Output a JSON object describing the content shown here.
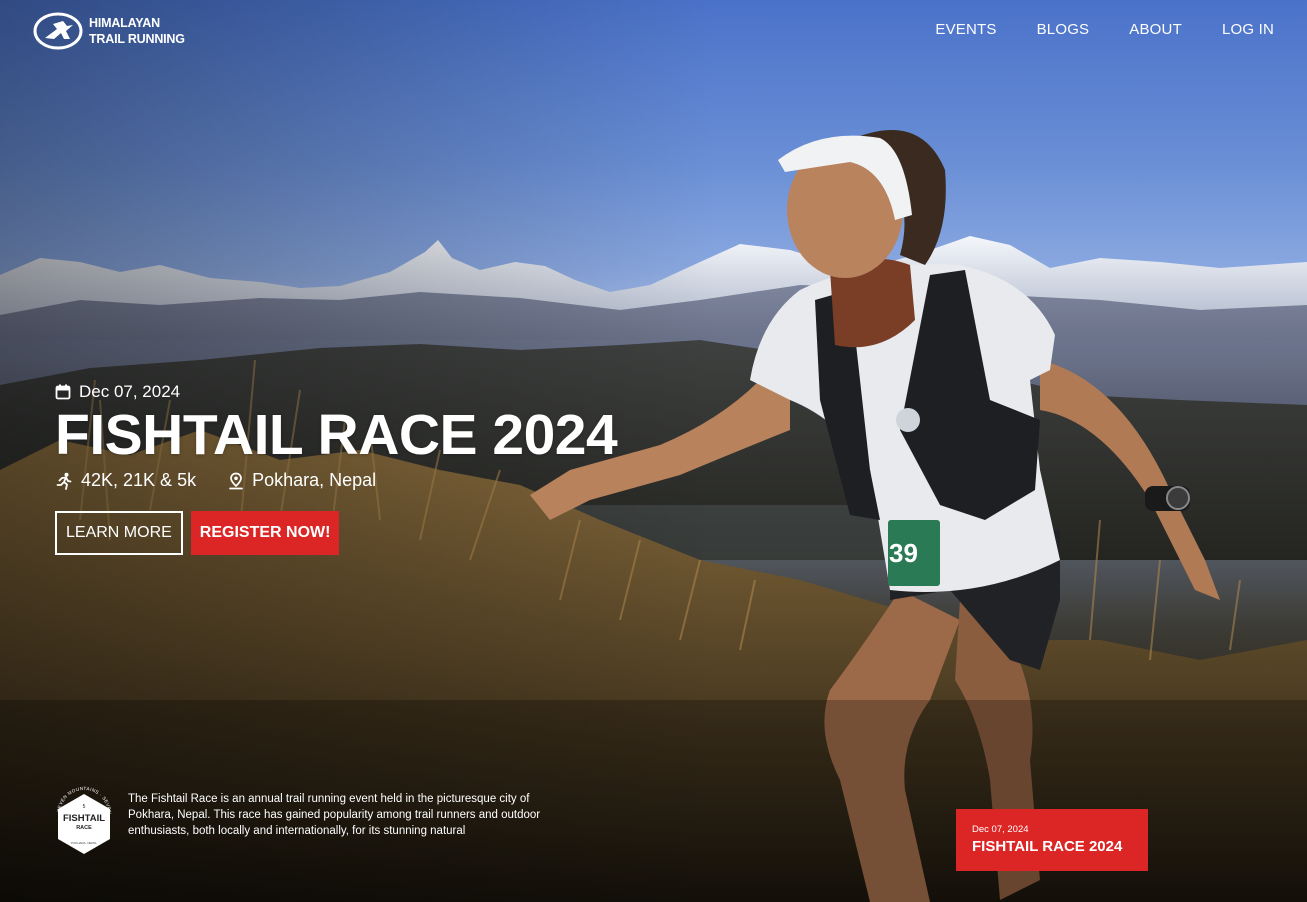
{
  "brand": {
    "line1": "HIMALAYAN",
    "line2": "TRAIL RUNNING"
  },
  "nav": {
    "events": "EVENTS",
    "blogs": "BLOGS",
    "about": "ABOUT",
    "login": "LOG IN"
  },
  "hero": {
    "date": "Dec 07, 2024",
    "title": "FISHTAIL RACE 2024",
    "distances": "42K, 21K & 5k",
    "location": "Pokhara, Nepal",
    "learn_more": "LEARN MORE",
    "register": "REGISTER NOW!"
  },
  "description": {
    "text": "The Fishtail Race is an annual trail running event held in the picturesque city of Pokhara, Nepal. This race has gained popularity among trail runners and outdoor enthusiasts, both locally and internationally, for its stunning natural",
    "badge": {
      "edition": "5",
      "line1": "FISHTAIL",
      "line2": "RACE",
      "ring_text": "SEVEN MOUNTAINS · SEVEN TRAILS",
      "city": "POKHARA, NEPAL"
    }
  },
  "card": {
    "date": "Dec 07, 2024",
    "title": "FISHTAIL RACE 2024"
  },
  "runner": {
    "bib": "39"
  },
  "colors": {
    "accent_red": "#dc2626",
    "text": "#ffffff"
  }
}
